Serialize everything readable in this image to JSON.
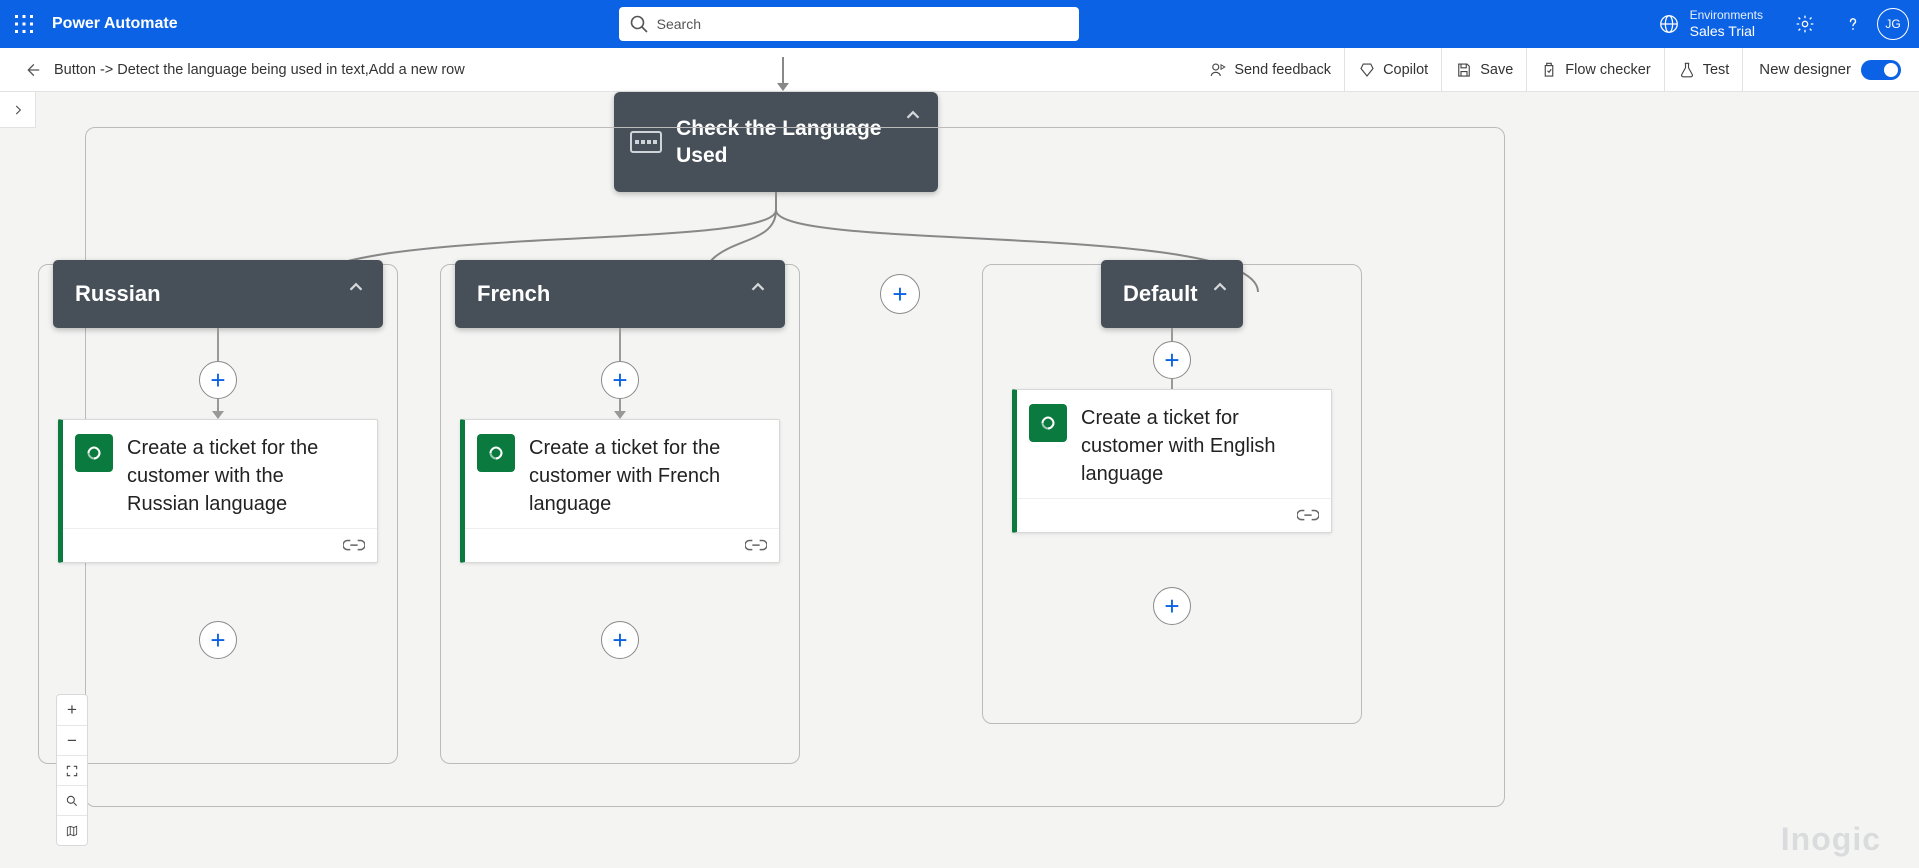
{
  "header": {
    "brand": "Power Automate",
    "search_placeholder": "Search",
    "env_label": "Environments",
    "env_name": "Sales Trial",
    "avatar_initials": "JG"
  },
  "cmdbar": {
    "breadcrumb": "Button -> Detect the language being used in text,Add a new row",
    "send_feedback": "Send feedback",
    "copilot": "Copilot",
    "save": "Save",
    "flow_checker": "Flow checker",
    "test": "Test",
    "new_designer": "New designer"
  },
  "switch_node": {
    "title": "Check the Language Used"
  },
  "cases": {
    "russian": {
      "label": "Russian",
      "action": "Create a ticket for the customer with the Russian language"
    },
    "french": {
      "label": "French",
      "action": "Create a ticket for the customer with French language"
    },
    "default": {
      "label": "Default",
      "action": "Create a ticket for customer with English language"
    }
  },
  "watermark": "Inogic"
}
